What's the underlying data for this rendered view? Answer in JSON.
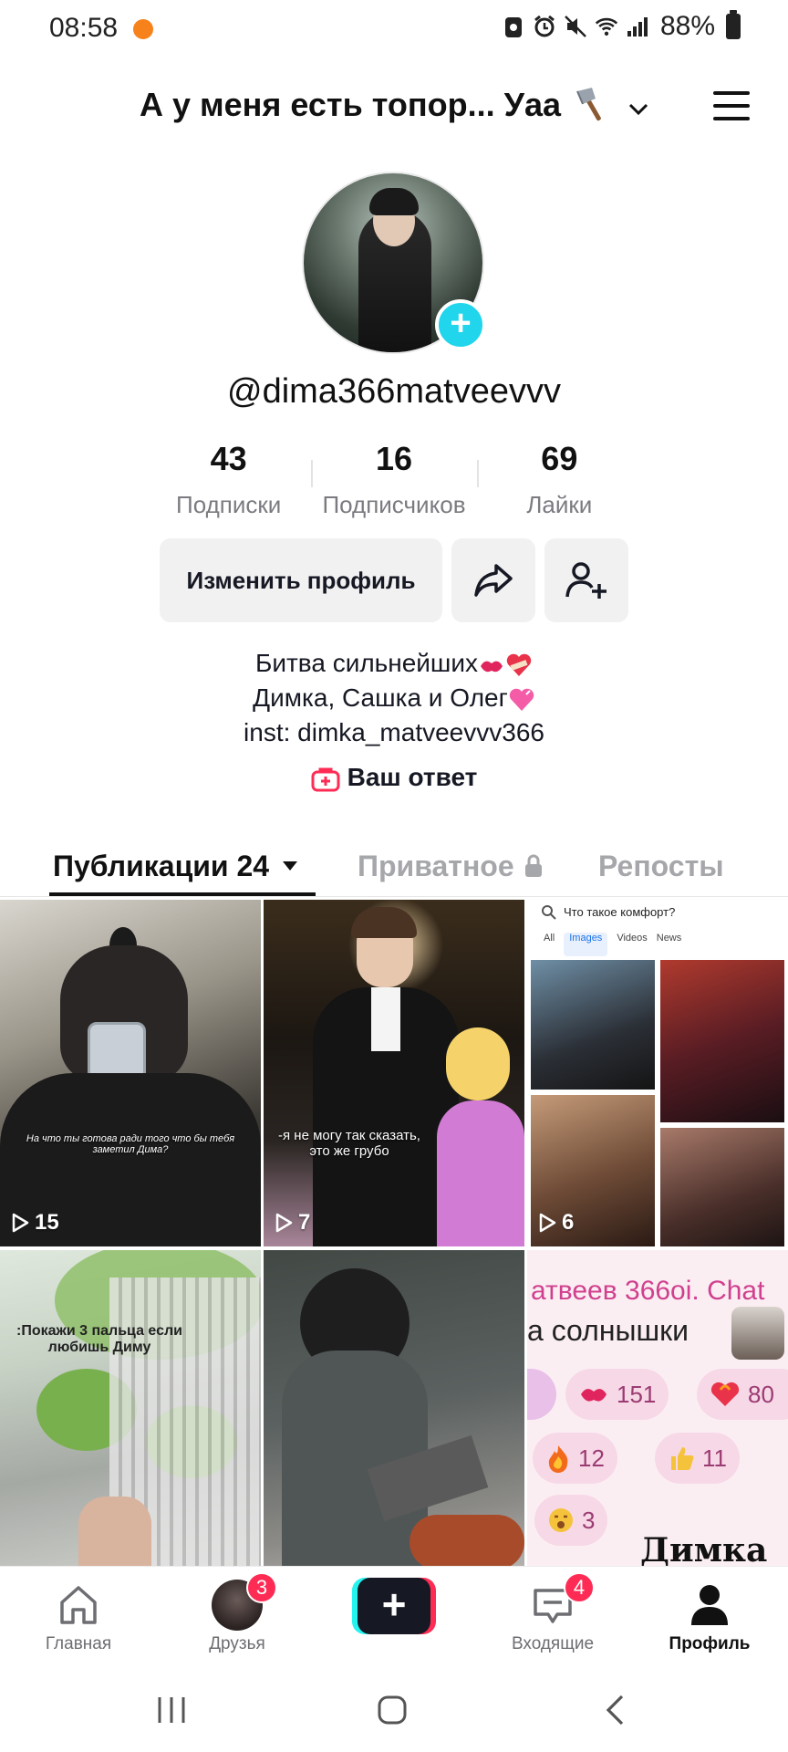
{
  "status_bar": {
    "time": "08:58",
    "battery": "88%",
    "icons": [
      "recording-icon",
      "alarm-icon",
      "mute-icon",
      "wifi-icon",
      "signal-icon",
      "battery-icon"
    ]
  },
  "header": {
    "title": "А у меня есть топор... Уаа"
  },
  "profile": {
    "username": "@dima366matveevvv",
    "stats": [
      {
        "value": "43",
        "label": "Подписки"
      },
      {
        "value": "16",
        "label": "Подписчиков"
      },
      {
        "value": "69",
        "label": "Лайки"
      }
    ],
    "edit_button": "Изменить профиль",
    "bio": {
      "line1": "Битва сильнейших",
      "line2": "Димка, Сашка и Олег",
      "line3": "inst: dimka_matveevvv366"
    },
    "answer": "Ваш ответ"
  },
  "tabs": {
    "publications": "Публикации",
    "publications_count": "24",
    "private": "Приватное",
    "reposts": "Репосты"
  },
  "grid": {
    "items": [
      {
        "views": "15",
        "caption": "На что ты готова ради того что бы тебя заметил Дима?"
      },
      {
        "views": "7",
        "caption": "-я не могу так сказать, это же грубо"
      },
      {
        "views": "6",
        "search": "Что такое комфорт?",
        "tabs": [
          "All",
          "Images",
          "Videos",
          "News"
        ]
      },
      {
        "caption": ":Покажи 3 пальца если любишь Диму"
      },
      {},
      {
        "title": "атвеев 366oi. Chat",
        "subtitle": "а солнышки",
        "reactions": [
          "151",
          "80",
          "12",
          "11",
          "3"
        ],
        "bottom": "Димка"
      }
    ]
  },
  "bottom_nav": {
    "home": "Главная",
    "friends": "Друзья",
    "friends_badge": "3",
    "inbox": "Входящие",
    "inbox_badge": "4",
    "profile": "Профиль"
  },
  "colors": {
    "accent_cyan": "#20d5ec",
    "accent_red": "#fe2c55",
    "text_primary": "#161823",
    "text_secondary": "#7a7b80"
  }
}
